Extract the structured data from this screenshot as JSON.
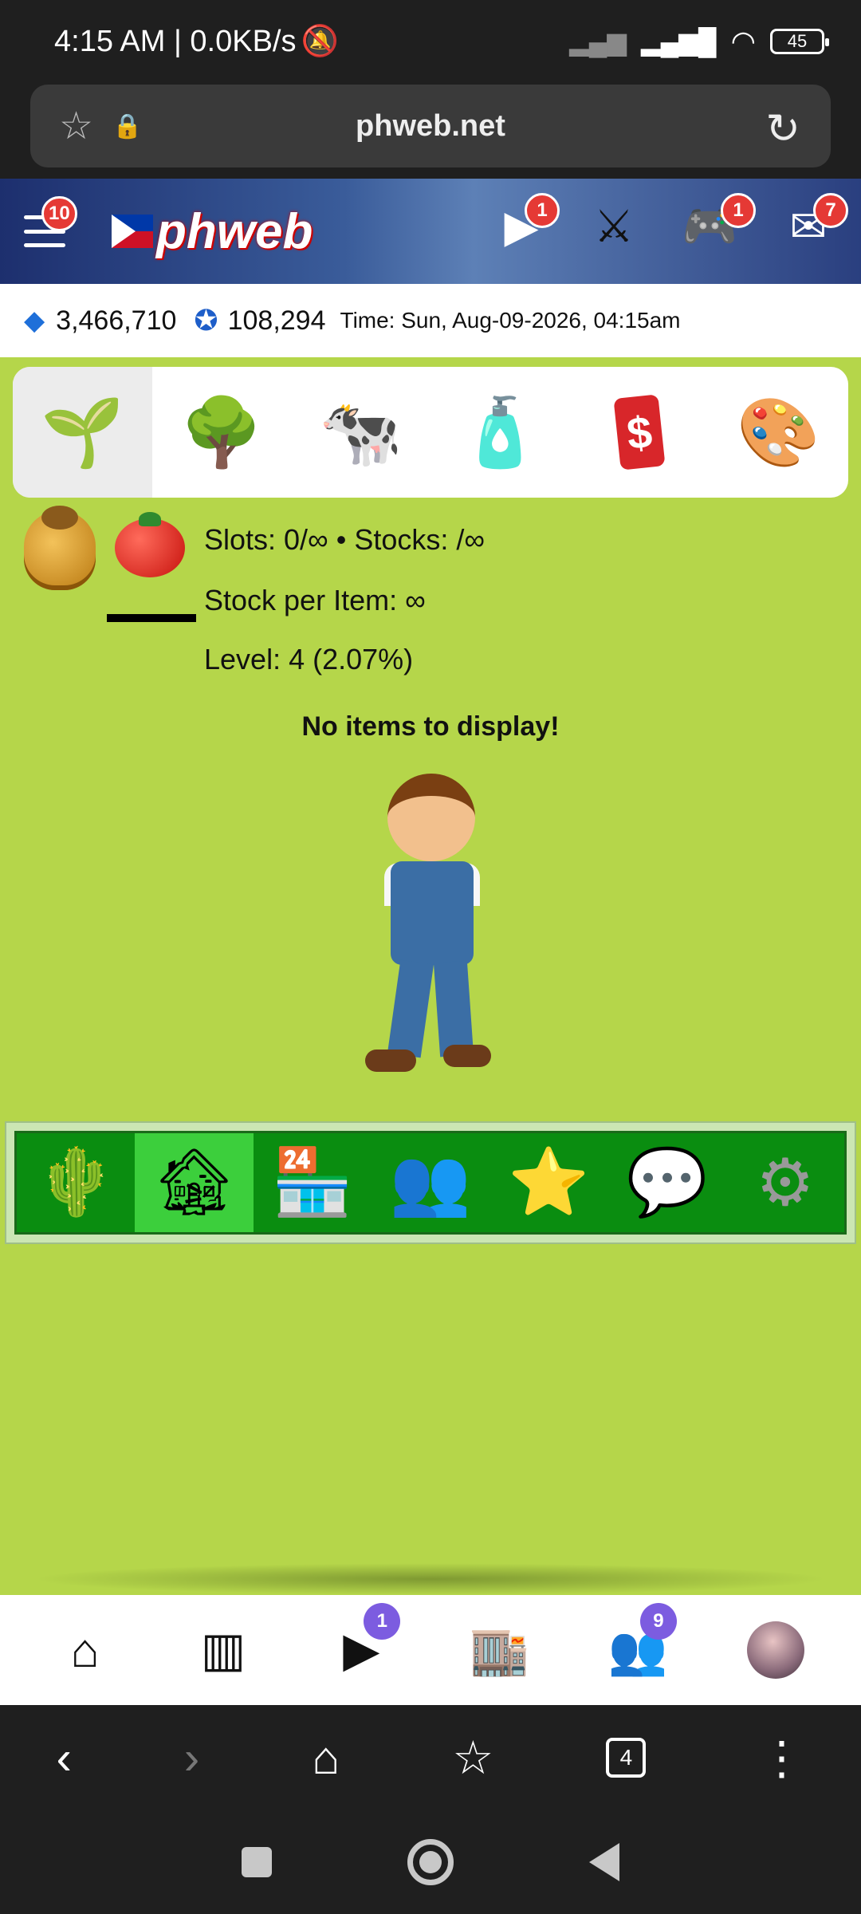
{
  "status_bar": {
    "time_net": "4:15 AM | 0.0KB/s",
    "battery": "45"
  },
  "browser": {
    "url": "phweb.net"
  },
  "site_header": {
    "logo": "phweb",
    "menu_badge": "10",
    "videos_badge": "1",
    "games_badge": "1",
    "inbox_badge": "7"
  },
  "info_bar": {
    "gems": "3,466,710",
    "points": "108,294",
    "time": "Time: Sun, Aug-09-2026, 04:15am"
  },
  "category_tabs": [
    {
      "icon": "seedling-icon"
    },
    {
      "icon": "tree-icon"
    },
    {
      "icon": "cow-icon"
    },
    {
      "icon": "spray-can-icon"
    },
    {
      "icon": "dollar-card-icon"
    },
    {
      "icon": "paint-palette-icon"
    }
  ],
  "stats": {
    "slots_stocks": "Slots: 0/∞ • Stocks: /∞",
    "stock_per_item": "Stock per Item: ∞",
    "level": "Level: 4 (2.07%)"
  },
  "empty_message": "No items to display!",
  "farm_nav": [
    {
      "icon": "farm-plot-icon"
    },
    {
      "icon": "barn-icon"
    },
    {
      "icon": "shop-icon"
    },
    {
      "icon": "neighbors-icon"
    },
    {
      "icon": "favorite-user-icon"
    },
    {
      "icon": "chat-icon"
    },
    {
      "icon": "settings-gears-icon"
    }
  ],
  "app_nav": {
    "videos_badge": "1",
    "community_badge": "9"
  },
  "browser_nav": {
    "tabs_count": "4"
  },
  "colors": {
    "grass": "#b5d64a",
    "farm_nav_green": "#0a8d10",
    "farm_nav_active": "#3ccf3c",
    "badge_red": "#e53935",
    "badge_purple": "#7c5ce0"
  }
}
